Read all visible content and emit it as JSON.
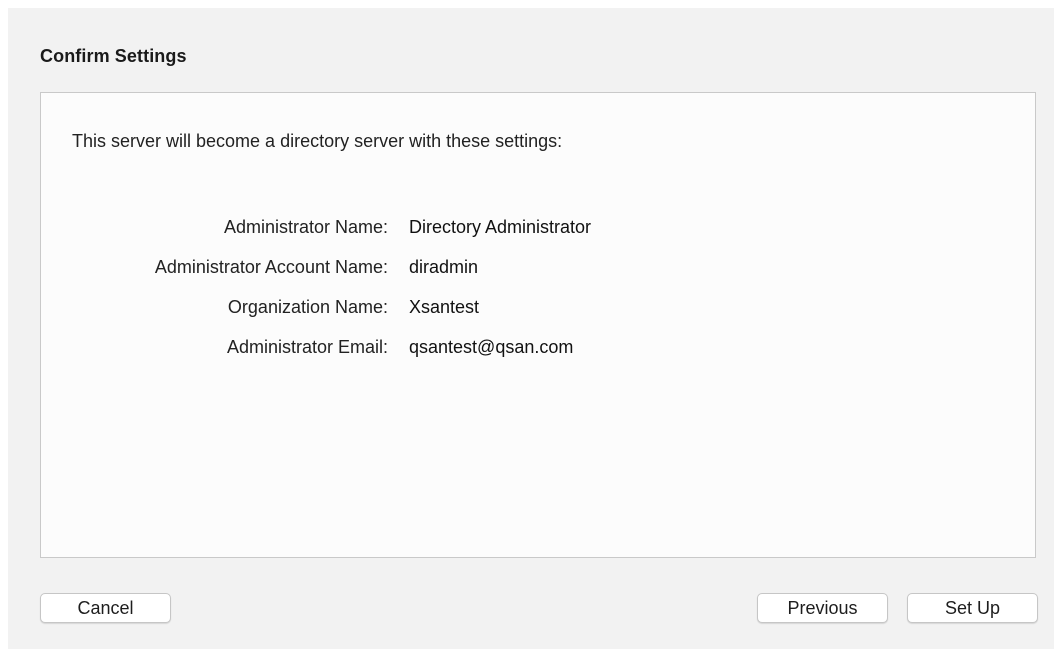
{
  "dialog": {
    "title": "Confirm Settings",
    "intro": "This server will become a directory server with these settings:",
    "settings": [
      {
        "label": "Administrator Name:",
        "value": "Directory Administrator"
      },
      {
        "label": "Administrator Account Name:",
        "value": "diradmin"
      },
      {
        "label": "Organization Name:",
        "value": "Xsantest"
      },
      {
        "label": "Administrator Email:",
        "value": "qsantest@qsan.com"
      }
    ]
  },
  "buttons": {
    "cancel": "Cancel",
    "previous": "Previous",
    "setup": "Set Up"
  },
  "colors": {
    "sheet_background": "#f2f2f2",
    "content_background": "#fcfcfc",
    "border": "#c9c9c9"
  }
}
